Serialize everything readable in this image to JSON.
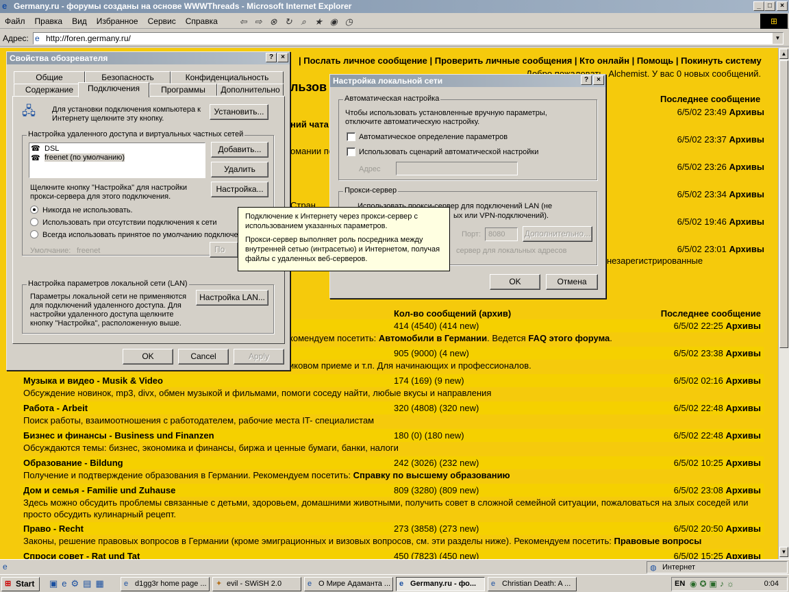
{
  "window": {
    "title": "Germany.ru - форумы созданы на основе WWWThreads - Microsoft Internet Explorer"
  },
  "menu": [
    "Файл",
    "Правка",
    "Вид",
    "Избранное",
    "Сервис",
    "Справка"
  ],
  "address": {
    "label": "Адрес:",
    "url": "http://foren.germany.ru/"
  },
  "page": {
    "topnav": "| Послать личное сообщение | Проверить личные сообщения | Кто онлайн | Помощь | Покинуть систему",
    "welcome": "Добро пожаловать, Alchemist. У вас 0 новых сообщений.",
    "heading_fragment": "льзов",
    "last_post_header": "Последнее сообщение",
    "archive": "Архивы",
    "top_dates": [
      "6/5/02 23:49",
      "6/5/02 23:37",
      "6/5/02 23:26",
      "6/5/02 23:34",
      "6/5/02 19:46",
      "6/5/02 23:01"
    ],
    "fragments": {
      "chat": "ний чата",
      "omani": "омании по",
      "unreg": "незарегистрированные",
      "stran": "Стран"
    },
    "section2_count_header": "Кол-во сообщений (архив)",
    "section2_last_header": "Последнее сообщение",
    "row1": {
      "count": "414 (4540) (414 new)",
      "date": "6/5/02 22:25",
      "desc_pre": "комендуем посетить: ",
      "desc_link": "Автомобили в Германии",
      "desc_mid": ". Ведется ",
      "desc_faq": "FAQ этого форума",
      "desc_end": "."
    },
    "row2": {
      "count": "905 (9000) (4 new)",
      "date": "6/5/02 23:38",
      "desc": "иковом приеме и т.п. Для начинающих и профессионалов."
    },
    "forums": [
      {
        "title": "Музыка и видео - Musik & Video",
        "count": "174 (169) (9 new)",
        "date": "6/5/02 02:16",
        "desc": "Обсуждение новинок, mp3, divx, обмен музыкой и фильмами, помоги соседу найти, любые вкусы и направления"
      },
      {
        "title": "Работа - Arbeit",
        "count": "320 (4808) (320 new)",
        "date": "6/5/02 22:48",
        "desc": "Поиск работы, взаимоотношения с работодателем, рабочие места IT- специалистам"
      },
      {
        "title": "Бизнес и финансы - Business und Finanzen",
        "count": "180 (0) (180 new)",
        "date": "6/5/02 22:48",
        "desc": "Обсуждаются темы: бизнес, экономика и финансы, биржа и ценные бумаги, банки, налоги"
      },
      {
        "title": "Образование - Bildung",
        "count": "242 (3026) (232 new)",
        "date": "6/5/02 10:25",
        "desc": "Получение и подтверждение образования в Германии. Рекомендуем посетить: ",
        "desc_link": "Справку по высшему образованию"
      },
      {
        "title": "Дом и семья - Familie und Zuhause",
        "count": "809 (3280) (809 new)",
        "date": "6/5/02 23:08",
        "desc": "Здесь можно обсудить проблемы связанные с детьми, здоровьем, домашними животными, получить совет в сложной семейной ситуации, пожаловаться на злых соседей или",
        "desc2": "просто обсудить кулинарный рецепт."
      },
      {
        "title": "Право - Recht",
        "count": "273 (3858) (273 new)",
        "date": "6/5/02 20:50",
        "desc": "Законы, решение правовых вопросов в Германии (кроме эмиграционных и визовых вопросов, см. эти разделы ниже). Рекомендуем посетить: ",
        "desc_link": "Правовые вопросы"
      },
      {
        "title": "Спроси совет - Rat und Tat",
        "count": "450 (7823) (450 new)",
        "date": "6/5/02 15:25"
      }
    ]
  },
  "props_dialog": {
    "title": "Свойства обозревателя",
    "tabs_row1": [
      "Общие",
      "Безопасность",
      "Конфиденциальность"
    ],
    "tabs_row2": [
      "Содержание",
      "Подключения",
      "Программы",
      "Дополнительно"
    ],
    "setup_text": "Для установки подключения компьютера к Интернету щелкните эту кнопку.",
    "setup_btn": "Установить...",
    "dialup_group": "Настройка удаленного доступа и виртуальных частных сетей",
    "connections": [
      "DSL",
      "freenet (по умолчанию)"
    ],
    "add_btn": "Добавить...",
    "remove_btn": "Удалить",
    "settings_text": "Щелкните кнопку \"Настройка\" для настройки прокси-сервера для этого подключения.",
    "settings_btn": "Настройка...",
    "radio_never": "Никогда не использовать.",
    "radio_absent": "Использовать при отсутствии подключения к сети",
    "radio_always": "Всегда использовать принятое по умолчанию подключе",
    "default_label": "Умолчание:",
    "default_value": "freenet",
    "default_btn": "По умо",
    "lan_group": "Настройка параметров локальной сети (LAN)",
    "lan_text": "Параметры локальной сети не применяются для подключений удаленного доступа. Для настройки удаленного доступа щелкните кнопку \"Настройка\", расположенную выше.",
    "lan_btn": "Настройка LAN...",
    "ok": "OK",
    "cancel": "Cancel",
    "apply": "Apply"
  },
  "lan_dialog": {
    "title": "Настройка локальной сети",
    "auto_group": "Автоматическая настройка",
    "auto_text": "Чтобы использовать установленные вручную параметры, отключите автоматическую настройку.",
    "auto_detect": "Автоматическое определение параметров",
    "auto_script": "Использовать сценарий автоматической настройки",
    "address_label": "Адрес",
    "proxy_group": "Прокси-сервер",
    "proxy_text": "Использовать прокси-сервер для подключений LAN (не",
    "proxy_text2": "ых или VPN-подключений).",
    "port_label": "Порт:",
    "port_value": "8080",
    "advanced_btn": "Дополнительно...",
    "bypass_text": "сервер для локальных адресов",
    "ok": "OK",
    "cancel": "Отмена"
  },
  "tooltip": {
    "p1": "Подключение к Интернету через прокси-сервер с использованием указанных параметров.",
    "p2": "Прокси-сервер выполняет роль посредника между внутренней сетью (интрасетью) и Интернетом, получая файлы с удаленных веб-серверов."
  },
  "status": {
    "zone": "Интернет"
  },
  "taskbar": {
    "start": "Start",
    "tasks": [
      "d1gg3r home page ...",
      "evil - SWiSH 2.0",
      "О Мире Адаманта ...",
      "Germany.ru - фо...",
      "Christian Death: A ..."
    ],
    "lang": "EN",
    "clock": "0:04"
  }
}
